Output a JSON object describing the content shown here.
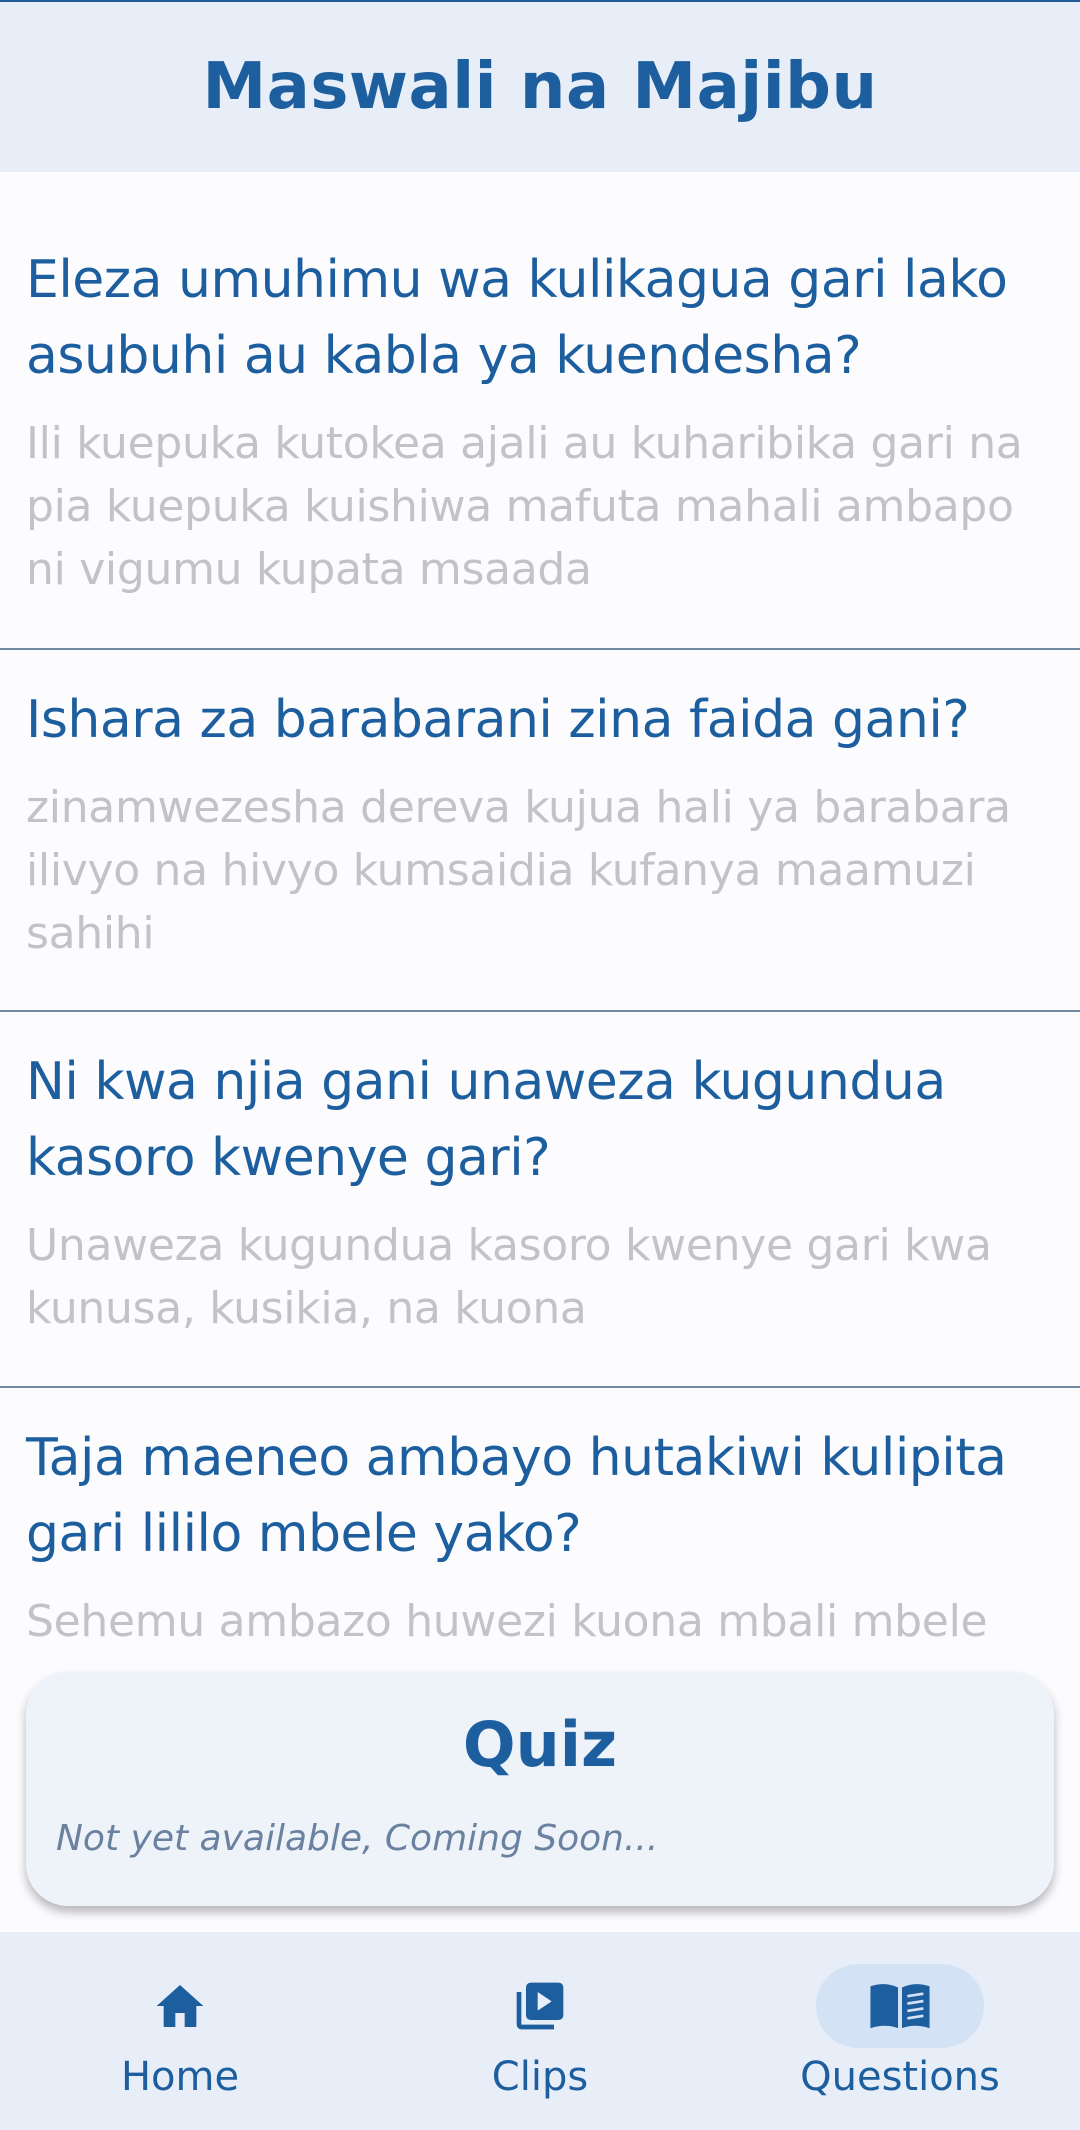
{
  "header": {
    "title": "Maswali na Majibu"
  },
  "qa_items": [
    {
      "question": "Eleza umuhimu wa kulikagua gari lako asubuhi au kabla ya kuendesha?",
      "answer": "Ili kuepuka kutokea ajali au kuharibika gari na pia kuepuka kuishiwa mafuta mahali ambapo ni vigumu kupata msaada"
    },
    {
      "question": "Ishara za barabarani zina faida gani?",
      "answer": "zinamwezesha dereva kujua hali ya barabara ilivyo na hivyo kumsaidia kufanya maamuzi sahihi"
    },
    {
      "question": "Ni kwa njia gani unaweza kugundua kasoro kwenye gari?",
      "answer": "Unaweza kugundua kasoro kwenye gari kwa kunusa, kusikia, na kuona"
    },
    {
      "question": "Taja maeneo ambayo hutakiwi kulipita gari lililo mbele yako?",
      "answer": "Sehemu ambazo huwezi kuona mbali mbele"
    }
  ],
  "quiz": {
    "title": "Quiz",
    "subtitle": "Not yet available, Coming Soon..."
  },
  "nav": {
    "items": [
      {
        "label": "Home",
        "icon": "home-icon"
      },
      {
        "label": "Clips",
        "icon": "video-library-icon"
      },
      {
        "label": "Questions",
        "icon": "book-icon",
        "active": true
      }
    ]
  },
  "colors": {
    "primary": "#1d5e9f",
    "answer_text": "#c3c3c6",
    "bar_background": "#e8eef7",
    "active_pill": "#d4e2f6"
  }
}
